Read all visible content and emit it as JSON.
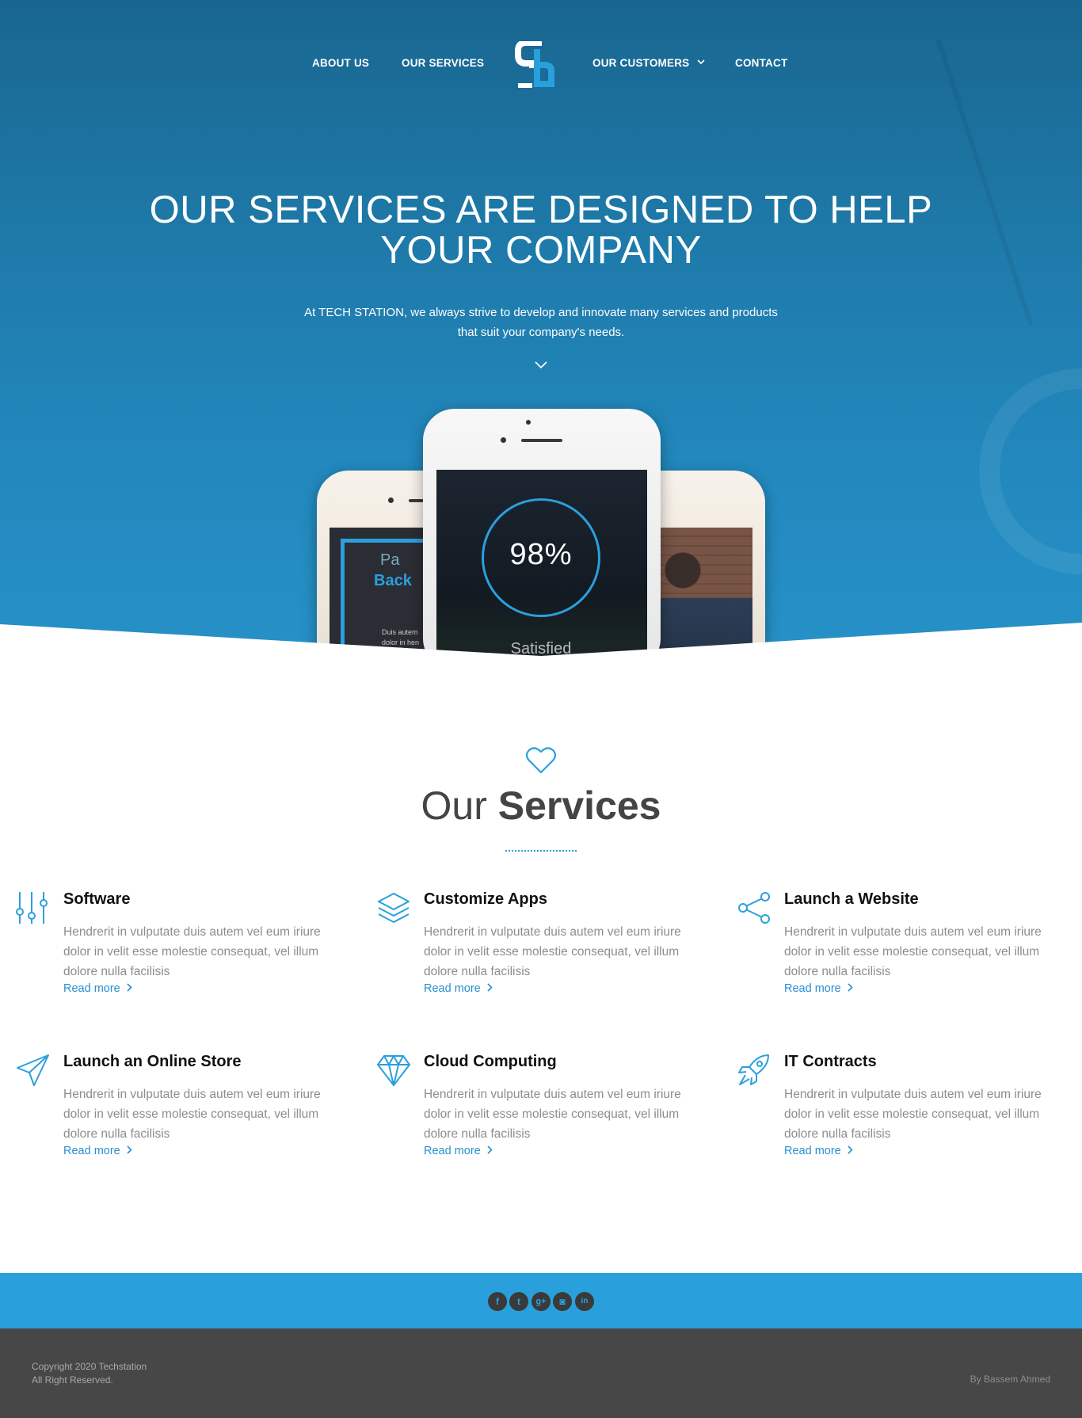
{
  "nav": {
    "about": "ABOUT US",
    "services": "OUR SERVICES",
    "customers": "OUR CUSTOMERS",
    "contact": "CONTACT"
  },
  "hero": {
    "title_line1": "OUR SERVICES ARE DESIGNED TO HELP",
    "title_line2": "YOUR COMPANY",
    "subtitle": "At TECH STATION, we always strive to develop and innovate many services and products that suit your company's needs."
  },
  "phones": {
    "stat_value": "98%",
    "stat_label": "Satisfied",
    "left_word1": "Pa",
    "left_word2": "Back",
    "left_tiny": "Duis autem dolor in hen"
  },
  "services_section": {
    "title_light": "Our ",
    "title_bold": "Services",
    "items": [
      {
        "title": "Software",
        "desc": "Hendrerit in vulputate duis autem vel eum iriure dolor in velit esse molestie consequat, vel illum dolore nulla facilisis",
        "more": "Read more",
        "icon": "sliders-icon"
      },
      {
        "title": "Customize Apps",
        "desc": "Hendrerit in vulputate duis autem vel eum iriure dolor in velit esse molestie consequat, vel illum dolore nulla facilisis",
        "more": "Read more",
        "icon": "layers-icon"
      },
      {
        "title": "Launch a Website",
        "desc": "Hendrerit in vulputate duis autem vel eum iriure dolor in velit esse molestie consequat, vel illum dolore nulla facilisis",
        "more": "Read more",
        "icon": "share-icon"
      },
      {
        "title": "Launch an Online Store",
        "desc": "Hendrerit in vulputate duis autem vel eum iriure dolor in velit esse molestie consequat, vel illum dolore nulla facilisis",
        "more": "Read more",
        "icon": "paper-plane-icon"
      },
      {
        "title": "Cloud Computing",
        "desc": "Hendrerit in vulputate duis autem vel eum iriure dolor in velit esse molestie consequat, vel illum dolore nulla facilisis",
        "more": "Read more",
        "icon": "diamond-icon"
      },
      {
        "title": "IT Contracts",
        "desc": "Hendrerit in vulputate duis autem vel eum iriure dolor in velit esse molestie consequat, vel illum dolore nulla facilisis",
        "more": "Read more",
        "icon": "rocket-icon"
      }
    ]
  },
  "social": [
    {
      "name": "facebook-icon",
      "glyph": "f"
    },
    {
      "name": "twitter-icon",
      "glyph": "t"
    },
    {
      "name": "google-plus-icon",
      "glyph": "g+"
    },
    {
      "name": "instagram-icon",
      "glyph": "◙"
    },
    {
      "name": "linkedin-icon",
      "glyph": "in"
    }
  ],
  "footer": {
    "copyright_line1": "Copyright 2020 Techstation",
    "copyright_line2": "All Right Reserved.",
    "byline": "By Bassem Ahmed"
  },
  "colors": {
    "accent": "#2aa0dd",
    "hero_top": "#18668f",
    "hero_bottom": "#2691c8",
    "social_bar": "#29a0dc",
    "footer": "#474747"
  }
}
